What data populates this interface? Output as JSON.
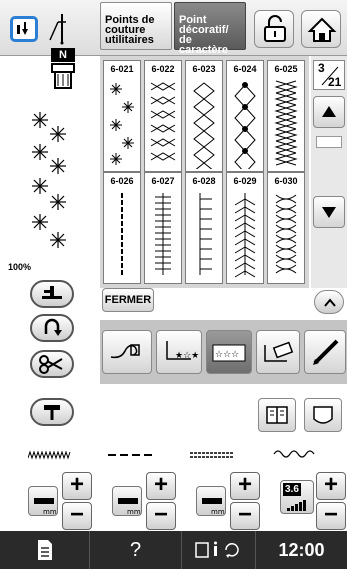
{
  "header": {
    "tab_utility": "Points de\ncouture\nutilitaires",
    "tab_decorative": "Point\ndécoratif/\nde caractère"
  },
  "left": {
    "presser_foot_letter": "N",
    "width_percent": "100%"
  },
  "grid": {
    "cells": [
      {
        "code": "6-021"
      },
      {
        "code": "6-022"
      },
      {
        "code": "6-023"
      },
      {
        "code": "6-024"
      },
      {
        "code": "6-025"
      },
      {
        "code": "6-026"
      },
      {
        "code": "6-027"
      },
      {
        "code": "6-028"
      },
      {
        "code": "6-029"
      },
      {
        "code": "6-030"
      }
    ]
  },
  "pager": {
    "current": "3",
    "total": "21"
  },
  "mid": {
    "close_label": "FERMER"
  },
  "controls": {
    "tension_value": "3.6"
  },
  "footer": {
    "clock": "12:00",
    "help_label": "?"
  },
  "colors": {
    "active_blue": "#2a7fd4",
    "bottom_bar": "#2a2a2a",
    "grid_bg": "#d6d6d6"
  }
}
